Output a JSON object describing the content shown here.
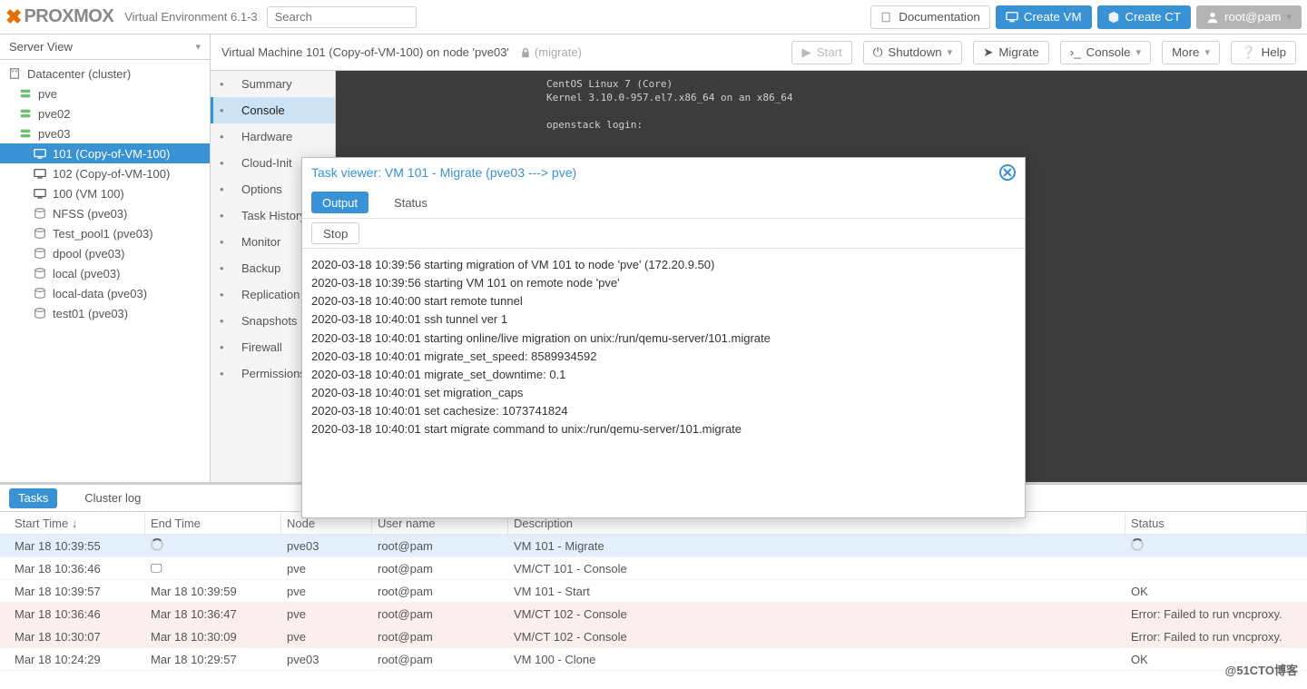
{
  "header": {
    "version": "Virtual Environment 6.1-3",
    "search_placeholder": "Search",
    "documentation": "Documentation",
    "create_vm": "Create VM",
    "create_ct": "Create CT",
    "user": "root@pam"
  },
  "sidebar": {
    "view_label": "Server View",
    "tree": [
      {
        "label": "Datacenter (cluster)",
        "depth": 0,
        "icon": "building"
      },
      {
        "label": "pve",
        "depth": 1,
        "icon": "server"
      },
      {
        "label": "pve02",
        "depth": 1,
        "icon": "server"
      },
      {
        "label": "pve03",
        "depth": 1,
        "icon": "server"
      },
      {
        "label": "101 (Copy-of-VM-100)",
        "depth": 2,
        "icon": "vm",
        "selected": true
      },
      {
        "label": "102 (Copy-of-VM-100)",
        "depth": 2,
        "icon": "vm"
      },
      {
        "label": "100 (VM 100)",
        "depth": 2,
        "icon": "vm"
      },
      {
        "label": "NFSS (pve03)",
        "depth": 2,
        "icon": "storage"
      },
      {
        "label": "Test_pool1 (pve03)",
        "depth": 2,
        "icon": "storage"
      },
      {
        "label": "dpool (pve03)",
        "depth": 2,
        "icon": "storage"
      },
      {
        "label": "local (pve03)",
        "depth": 2,
        "icon": "storage"
      },
      {
        "label": "local-data (pve03)",
        "depth": 2,
        "icon": "storage"
      },
      {
        "label": "test01 (pve03)",
        "depth": 2,
        "icon": "storage"
      }
    ]
  },
  "content_bar": {
    "title": "Virtual Machine 101 (Copy-of-VM-100) on node 'pve03'",
    "lock_label": "(migrate)",
    "start": "Start",
    "shutdown": "Shutdown",
    "migrate": "Migrate",
    "console": "Console",
    "more": "More",
    "help": "Help"
  },
  "menu": [
    {
      "label": "Summary",
      "icon": "list"
    },
    {
      "label": "Console",
      "icon": "terminal",
      "selected": true
    },
    {
      "label": "Hardware",
      "icon": "desktop"
    },
    {
      "label": "Cloud-Init",
      "icon": "cloud"
    },
    {
      "label": "Options",
      "icon": "gear"
    },
    {
      "label": "Task History",
      "icon": "tasks"
    },
    {
      "label": "Monitor",
      "icon": "eye"
    },
    {
      "label": "Backup",
      "icon": "save"
    },
    {
      "label": "Replication",
      "icon": "refresh"
    },
    {
      "label": "Snapshots",
      "icon": "history"
    },
    {
      "label": "Firewall",
      "icon": "shield"
    },
    {
      "label": "Permissions",
      "icon": "users"
    }
  ],
  "terminal": {
    "lines": "CentOS Linux 7 (Core)\nKernel 3.10.0-957.el7.x86_64 on an x86_64\n\nopenstack login:"
  },
  "bottom": {
    "tabs": {
      "tasks": "Tasks",
      "cluster": "Cluster log"
    },
    "columns": {
      "start": "Start Time ↓",
      "end": "End Time",
      "node": "Node",
      "user": "User name",
      "desc": "Description",
      "status": "Status"
    },
    "rows": [
      {
        "start": "Mar 18 10:39:55",
        "end": "",
        "end_icon": "spin",
        "node": "pve03",
        "user": "root@pam",
        "desc": "VM 101 - Migrate",
        "status": "",
        "status_icon": "spin",
        "selected": true
      },
      {
        "start": "Mar 18 10:36:46",
        "end": "",
        "end_icon": "console",
        "node": "pve",
        "user": "root@pam",
        "desc": "VM/CT 101 - Console",
        "status": ""
      },
      {
        "start": "Mar 18 10:39:57",
        "end": "Mar 18 10:39:59",
        "node": "pve",
        "user": "root@pam",
        "desc": "VM 101 - Start",
        "status": "OK"
      },
      {
        "start": "Mar 18 10:36:46",
        "end": "Mar 18 10:36:47",
        "node": "pve",
        "user": "root@pam",
        "desc": "VM/CT 102 - Console",
        "status": "Error: Failed to run vncproxy.",
        "err": true
      },
      {
        "start": "Mar 18 10:30:07",
        "end": "Mar 18 10:30:09",
        "node": "pve",
        "user": "root@pam",
        "desc": "VM/CT 102 - Console",
        "status": "Error: Failed to run vncproxy.",
        "err": true
      },
      {
        "start": "Mar 18 10:24:29",
        "end": "Mar 18 10:29:57",
        "node": "pve03",
        "user": "root@pam",
        "desc": "VM 100 - Clone",
        "status": "OK"
      }
    ]
  },
  "modal": {
    "title": "Task viewer: VM 101 - Migrate (pve03 ---> pve)",
    "tab_output": "Output",
    "tab_status": "Status",
    "stop": "Stop",
    "log": [
      "2020-03-18 10:39:56 starting migration of VM 101 to node 'pve' (172.20.9.50)",
      "2020-03-18 10:39:56 starting VM 101 on remote node 'pve'",
      "2020-03-18 10:40:00 start remote tunnel",
      "2020-03-18 10:40:01 ssh tunnel ver 1",
      "2020-03-18 10:40:01 starting online/live migration on unix:/run/qemu-server/101.migrate",
      "2020-03-18 10:40:01 migrate_set_speed: 8589934592",
      "2020-03-18 10:40:01 migrate_set_downtime: 0.1",
      "2020-03-18 10:40:01 set migration_caps",
      "2020-03-18 10:40:01 set cachesize: 1073741824",
      "2020-03-18 10:40:01 start migrate command to unix:/run/qemu-server/101.migrate"
    ]
  },
  "watermark": "@51CTO博客"
}
